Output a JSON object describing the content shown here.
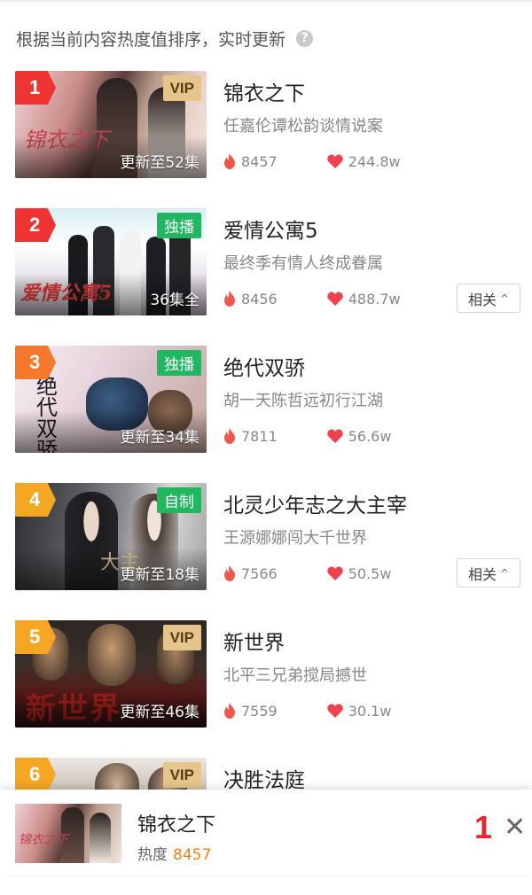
{
  "header": {
    "text": "根据当前内容热度值排序，实时更新",
    "help_icon": "question-circle-icon"
  },
  "colors": {
    "heat": "#f0574b",
    "like": "#f0414e",
    "rank_red": "#ef3333",
    "rank_orange": "#f5782d",
    "rank_yellow": "#f5a623",
    "vip_gold": "#e5c58b",
    "green_badge": "#21b760"
  },
  "items": [
    {
      "rank": "1",
      "title": "锦衣之下",
      "subtitle": "任嘉伦谭松韵谈情说案",
      "badge": "VIP",
      "episode": "更新至52集",
      "heat": "8457",
      "likes": "244.8w",
      "related": ""
    },
    {
      "rank": "2",
      "title": "爱情公寓5",
      "subtitle": "最终季有情人终成眷属",
      "badge": "独播",
      "episode": "36集全",
      "heat": "8456",
      "likes": "488.7w",
      "related": "相关"
    },
    {
      "rank": "3",
      "title": "绝代双骄",
      "subtitle": "胡一天陈哲远初行江湖",
      "badge": "独播",
      "episode": "更新至34集",
      "heat": "7811",
      "likes": "56.6w",
      "related": ""
    },
    {
      "rank": "4",
      "title": "北灵少年志之大主宰",
      "subtitle": "王源娜娜闯大千世界",
      "badge": "自制",
      "episode": "更新至18集",
      "heat": "7566",
      "likes": "50.5w",
      "related": "相关"
    },
    {
      "rank": "5",
      "title": "新世界",
      "subtitle": "北平三兄弟搅局撼世",
      "badge": "VIP",
      "episode": "更新至46集",
      "heat": "7559",
      "likes": "30.1w",
      "related": ""
    },
    {
      "rank": "6",
      "title": "决胜法庭",
      "subtitle": "",
      "badge": "VIP",
      "episode": "",
      "heat": "",
      "likes": "",
      "related": ""
    }
  ],
  "bottom_bar": {
    "title": "锦衣之下",
    "heat_label": "热度",
    "heat_value": "8457",
    "rank": "1",
    "close_icon": "close-x-icon"
  }
}
